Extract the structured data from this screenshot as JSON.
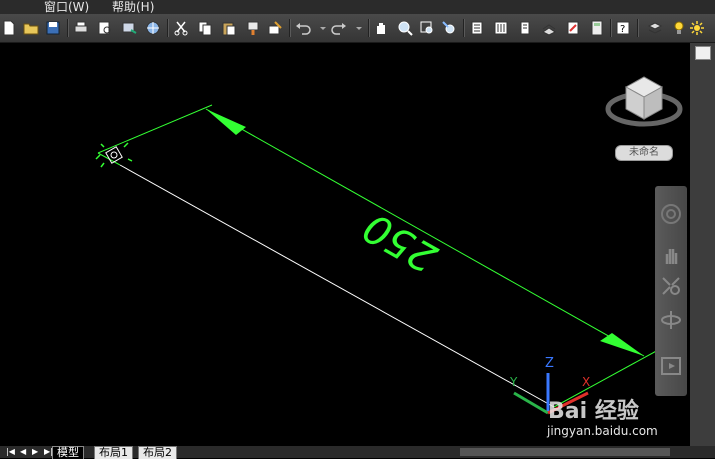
{
  "menu": {
    "window_label": "窗口(W)",
    "help_label": "帮助(H)"
  },
  "toolbar": {
    "icons": [
      "new-icon",
      "open-icon",
      "save-icon",
      "print-icon",
      "print-preview-icon",
      "publish-icon",
      "3d-publish-icon",
      "cut-icon",
      "copy-icon",
      "paste-icon",
      "match-properties-icon",
      "block-editor-icon",
      "undo-icon",
      "redo-icon",
      "pan-icon",
      "zoom-realtime-icon",
      "zoom-window-icon",
      "zoom-previous-icon",
      "properties-icon",
      "design-center-icon",
      "tool-palettes-icon",
      "sheet-set-icon",
      "markup-icon",
      "calculator-icon",
      "help-icon",
      "layer-icon",
      "light-bulb-icon",
      "sun-icon"
    ]
  },
  "viewport": {
    "dimension_text": "250",
    "viewcube_label": "未命名",
    "ucs_z": "Z",
    "ucs_y": "Y",
    "ucs_x": "X",
    "colors": {
      "dimension": "#33ff33",
      "line": "#ffffff",
      "background": "#000000"
    }
  },
  "tabs": {
    "model": "模型",
    "layout1": "布局1",
    "layout2": "布局2"
  },
  "watermark": {
    "brand": "Bai 经验",
    "url": "jingyan.baidu.com"
  }
}
